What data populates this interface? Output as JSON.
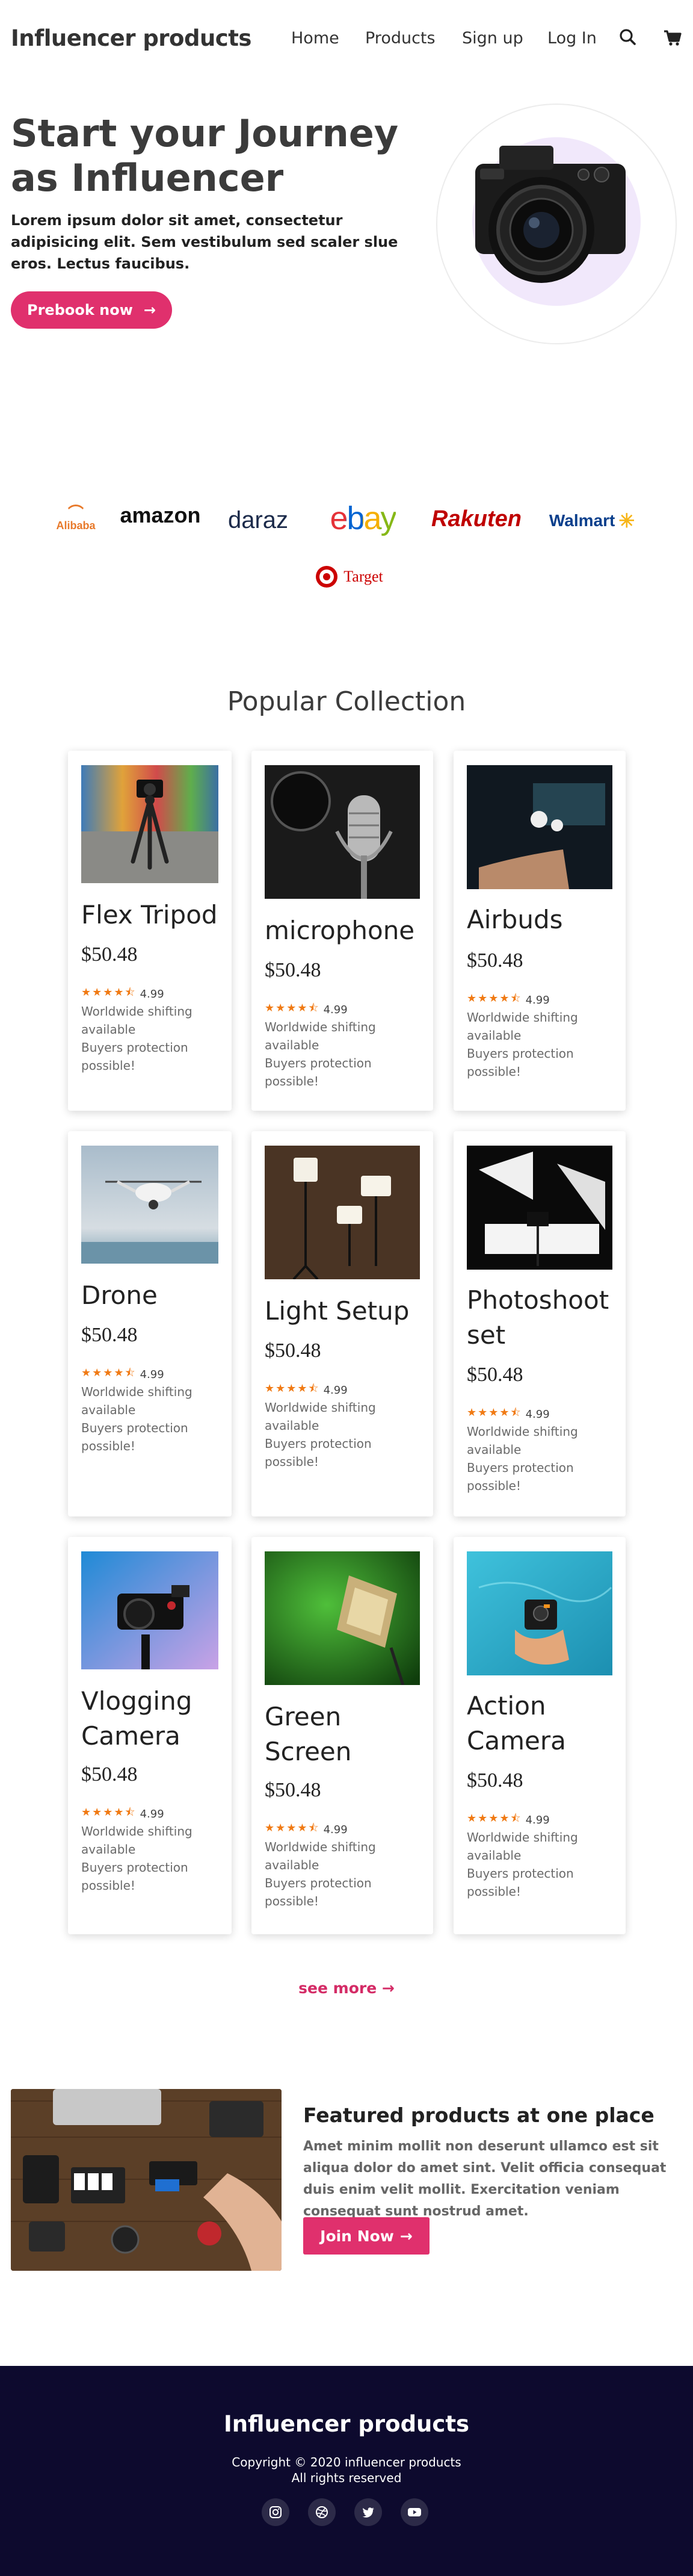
{
  "nav": {
    "brand": "Influencer products",
    "links": [
      "Home",
      "Products",
      "Sign up",
      "Log In"
    ],
    "icons": [
      "search-icon",
      "cart-icon"
    ]
  },
  "hero": {
    "title": "Start your Journey as Influencer",
    "text": "Lorem ipsum dolor sit amet, consectetur adipisicing elit. Sem vestibulum sed scaler slue eros. Lectus faucibus.",
    "button": "Prebook now",
    "arrow": "→",
    "circle_color": "#f1e8fb"
  },
  "partners": [
    "Alibaba",
    "amazon",
    "daraz",
    "ebay",
    "Rakuten",
    "Walmart",
    "Target"
  ],
  "collection": {
    "title": "Popular Collection",
    "products": [
      {
        "name": "Flex Tripod",
        "price": "$50.48",
        "rating": "4.99",
        "shipping": "Worldwide shifting available",
        "protection": "Buyers protection possible!"
      },
      {
        "name": "microphone",
        "price": "$50.48",
        "rating": "4.99",
        "shipping": "Worldwide shifting available",
        "protection": "Buyers protection possible!"
      },
      {
        "name": "Airbuds",
        "price": "$50.48",
        "rating": "4.99",
        "shipping": "Worldwide shifting available",
        "protection": "Buyers protection possible!"
      },
      {
        "name": "Drone",
        "price": "$50.48",
        "rating": "4.99",
        "shipping": "Worldwide shifting available",
        "protection": "Buyers protection possible!"
      },
      {
        "name": "Light Setup",
        "price": "$50.48",
        "rating": "4.99",
        "shipping": "Worldwide shifting available",
        "protection": "Buyers protection possible!"
      },
      {
        "name": "Photoshoot set",
        "price": "$50.48",
        "rating": "4.99",
        "shipping": "Worldwide shifting available",
        "protection": "Buyers protection possible!"
      },
      {
        "name": "Vlogging Camera",
        "price": "$50.48",
        "rating": "4.99",
        "shipping": "Worldwide shifting available",
        "protection": "Buyers protection possible!"
      },
      {
        "name": "Green Screen",
        "price": "$50.48",
        "rating": "4.99",
        "shipping": "Worldwide shifting available",
        "protection": "Buyers protection possible!"
      },
      {
        "name": "Action Camera",
        "price": "$50.48",
        "rating": "4.99",
        "shipping": "Worldwide shifting available",
        "protection": "Buyers protection possible!"
      }
    ],
    "stars": "★★★★⯪",
    "see_more": "see more",
    "see_more_arrow": "→"
  },
  "featured": {
    "title": "Featured products at one place",
    "text": "Amet minim mollit non deserunt ullamco est sit aliqua dolor do amet sint. Velit officia consequat duis enim velit mollit. Exercitation veniam consequat sunt nostrud amet.",
    "button": "Join Now",
    "arrow": "→"
  },
  "footer": {
    "brand": "Influencer products",
    "copyright": "Copyright © 2020 influencer products",
    "rights": "All rights reserved",
    "social": [
      "instagram-icon",
      "dribbble-icon",
      "twitter-icon",
      "youtube-icon"
    ]
  },
  "colors": {
    "accent": "#e0306d",
    "footer_bg": "#0d0a2e",
    "star": "#f07a14"
  }
}
